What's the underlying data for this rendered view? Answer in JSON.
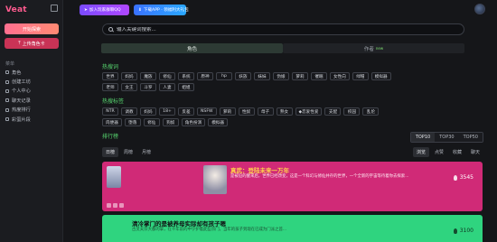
{
  "brand": {
    "logo_text": "Veat"
  },
  "sidebar": {
    "primary_button": "开始探索",
    "secondary_button": "上传角色卡",
    "section_label": "菜单",
    "items": [
      {
        "label": "角色"
      },
      {
        "label": "创建工坊"
      },
      {
        "label": "个人中心"
      },
      {
        "label": "聊天记录"
      },
      {
        "label": "热度排行"
      },
      {
        "label": "彩蛋片段"
      }
    ]
  },
  "topbar": {
    "join_group_button": "加入玩家群聊QQ",
    "download_button": "下载APP · 领福利大礼包"
  },
  "search": {
    "placeholder": "输入关键词搜索..."
  },
  "tabs": [
    {
      "label": "角色"
    },
    {
      "label": "作者",
      "badge": "new"
    }
  ],
  "hot_search": {
    "title": "热搜词",
    "row1": [
      "世界",
      "妈妈",
      "魔族",
      "修仙",
      "系统",
      "原神",
      "hp",
      "妖族",
      "妹妹",
      "伪娘",
      "萝莉",
      "催眠",
      "女性向",
      "绿帽",
      "模拟器"
    ],
    "row2": [
      "老师",
      "女王",
      "斗罗",
      "人妻",
      "姐姐"
    ]
  },
  "hot_tags": {
    "title": "热搜标签",
    "row1": [
      "NTR",
      "调教",
      "妈妈",
      "18+",
      "反差",
      "NSFW",
      "萝莉",
      "性奴",
      "母子",
      "熟女",
      "◆恋爱性爱",
      "支配",
      "校园",
      "乱伦"
    ],
    "row2": [
      "肉便器",
      "堕落",
      "修仙",
      "狗奴",
      "角色扮演",
      "模拟器"
    ]
  },
  "ranking": {
    "title": "排行榜",
    "range_tabs": [
      "TOP10",
      "TOP30",
      "TOP50"
    ],
    "period_tabs": [
      "日榜",
      "周榜",
      "月榜"
    ],
    "sort_tabs": [
      "浏览",
      "点赞",
      "收藏",
      "聊天"
    ]
  },
  "cards": [
    {
      "title": "真武：登陆未来一万年",
      "desc": "是被迫的醒来后，世界已经改变，这是一个科幻与修仙并存的世界，一个全新的宇宙等待着你去探索...",
      "score": "3545"
    },
    {
      "title": "清冷掌门的是被养母实际却有孩子嗯",
      "desc": "古灵夫宗大都的掌，在千年前的中宁护着此些宗门，当年的孩子到现在已成为门派之首...",
      "score": "3100"
    }
  ],
  "colors": {
    "accent_green": "#57d66f",
    "card_pink": "#d02a77",
    "card_green": "#2fd47f",
    "sidebar_pink": "#ff7a86",
    "sidebar_red": "#c93356"
  }
}
